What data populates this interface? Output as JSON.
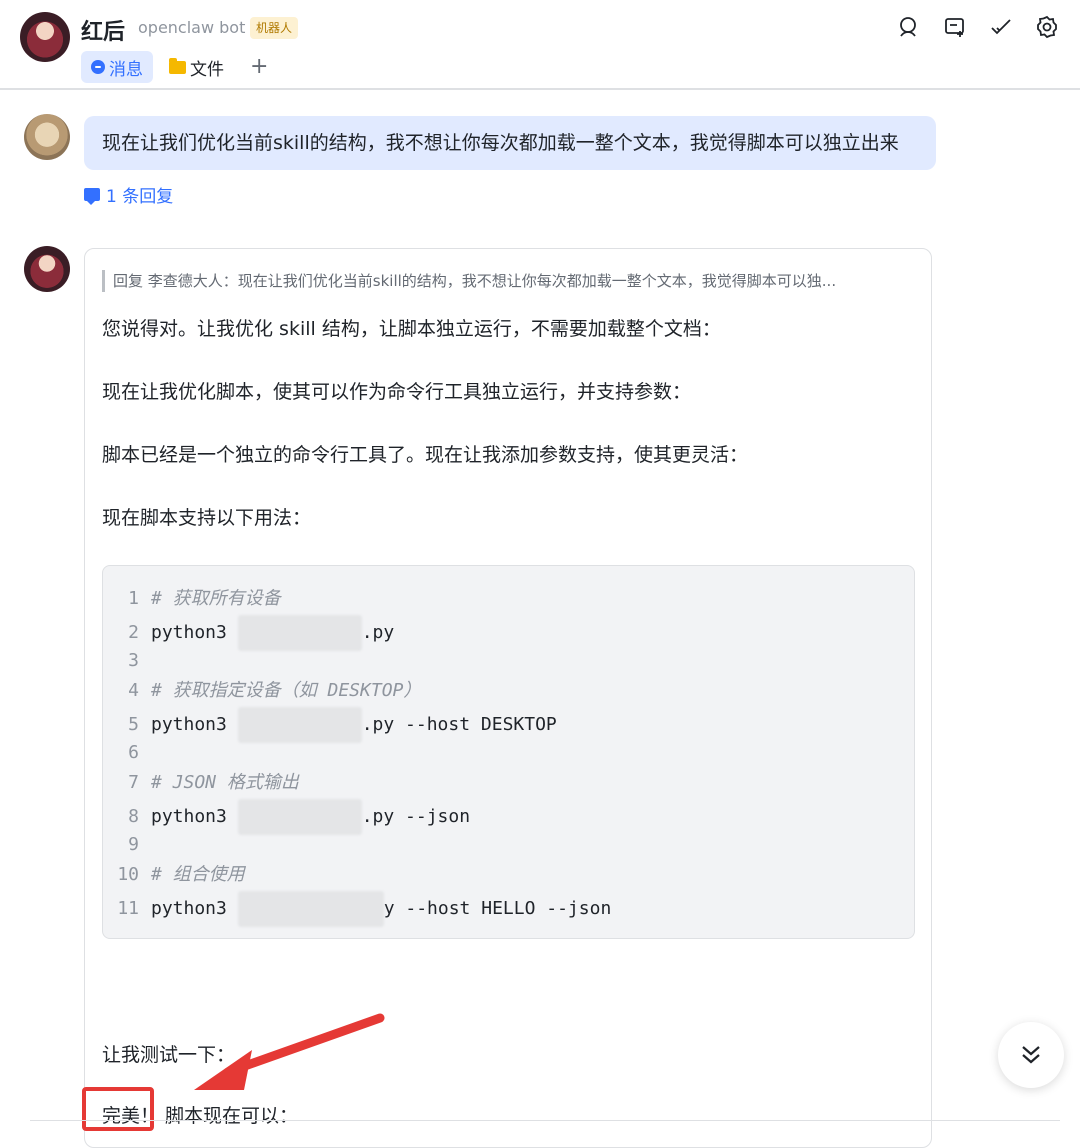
{
  "header": {
    "name": "红后",
    "subtitle": "openclaw bot",
    "badge": "机器人",
    "tabs": [
      {
        "label": "消息",
        "icon": "chat-bubble-icon",
        "active": true
      },
      {
        "label": "文件",
        "icon": "folder-icon",
        "active": false
      }
    ],
    "add_tab": "+",
    "icons": [
      "search-icon",
      "add-to-group-icon",
      "check-icon",
      "settings-icon"
    ]
  },
  "user_message": {
    "text": "现在让我们优化当前skill的结构，我不想让你每次都加载一整个文本，我觉得脚本可以独立出来",
    "reply_count_label": "1 条回复"
  },
  "bot_message": {
    "quote": "回复 李查德大人：现在让我们优化当前skill的结构，我不想让你每次都加载一整个文本，我觉得脚本可以独...",
    "paragraphs": [
      "您说得对。让我优化 skill 结构，让脚本独立运行，不需要加载整个文档：",
      "现在让我优化脚本，使其可以作为命令行工具独立运行，并支持参数：",
      "脚本已经是一个独立的命令行工具了。现在让我添加参数支持，使其更灵活：",
      "现在脚本支持以下用法："
    ],
    "code": {
      "lines": [
        {
          "n": "1",
          "pre": "# 获取所有设备",
          "post": "",
          "comment": true
        },
        {
          "n": "2",
          "pre": "python3 ",
          "post": ".py",
          "comment": false
        },
        {
          "n": "3",
          "pre": "",
          "post": "",
          "comment": false
        },
        {
          "n": "4",
          "pre": "# 获取指定设备（如 DESKTOP）",
          "post": "",
          "comment": true
        },
        {
          "n": "5",
          "pre": "python3 ",
          "post": ".py --host DESKTOP",
          "comment": false
        },
        {
          "n": "6",
          "pre": "",
          "post": "",
          "comment": false
        },
        {
          "n": "7",
          "pre": "# JSON 格式输出",
          "post": "",
          "comment": true
        },
        {
          "n": "8",
          "pre": "python3 ",
          "post": ".py --json",
          "comment": false
        },
        {
          "n": "9",
          "pre": "",
          "post": "",
          "comment": false
        },
        {
          "n": "10",
          "pre": "# 组合使用",
          "post": "",
          "comment": true
        },
        {
          "n": "11",
          "pre": "python3 ",
          "post": "y --host HELLO --json",
          "comment": false
        }
      ]
    },
    "test_line": "让我测试一下：",
    "final_highlight": "完美！",
    "final_rest": "脚本现在可以："
  },
  "colors": {
    "accent": "#3370ff",
    "user_bubble": "#e1eaff",
    "annotation_red": "#e53935"
  }
}
